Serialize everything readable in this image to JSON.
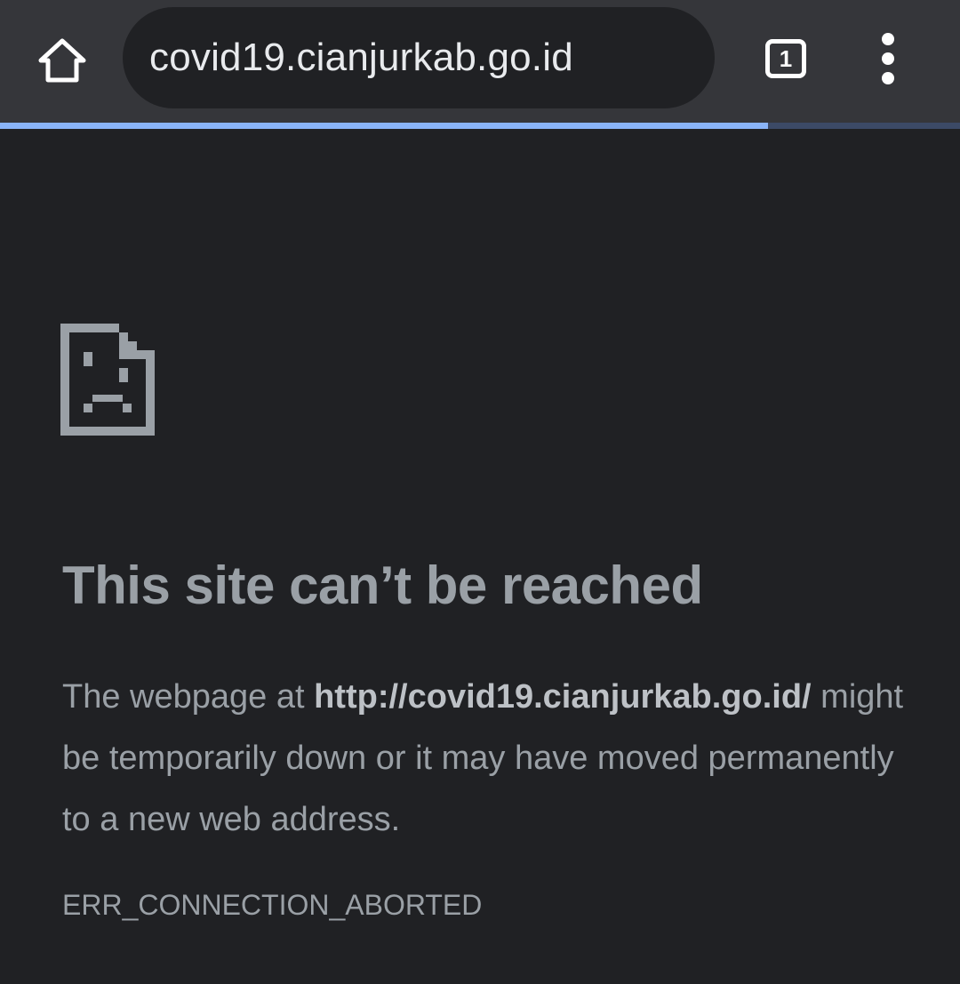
{
  "browser": {
    "url": "covid19.cianjurkab.go.id",
    "tab_count": "1",
    "load_progress_percent": 80,
    "icons": {
      "home": "home-icon",
      "tabs": "tab-switcher-icon",
      "menu": "more-vert-icon"
    },
    "colors": {
      "toolbar": "#35363a",
      "omnibox": "#202124",
      "progress": "#8ab4f8",
      "progress_track": "#3c4a66"
    }
  },
  "error_page": {
    "icon": "sad-page-icon",
    "title": "This site can’t be reached",
    "message_prefix": "The webpage at ",
    "message_url": "http://covid19.cianjurkab.go.id/",
    "message_suffix": " might be temporarily down or it may have moved permanently to a new web address.",
    "error_code": "ERR_CONNECTION_ABORTED",
    "colors": {
      "background": "#202124",
      "text": "#9aa0a6"
    }
  }
}
